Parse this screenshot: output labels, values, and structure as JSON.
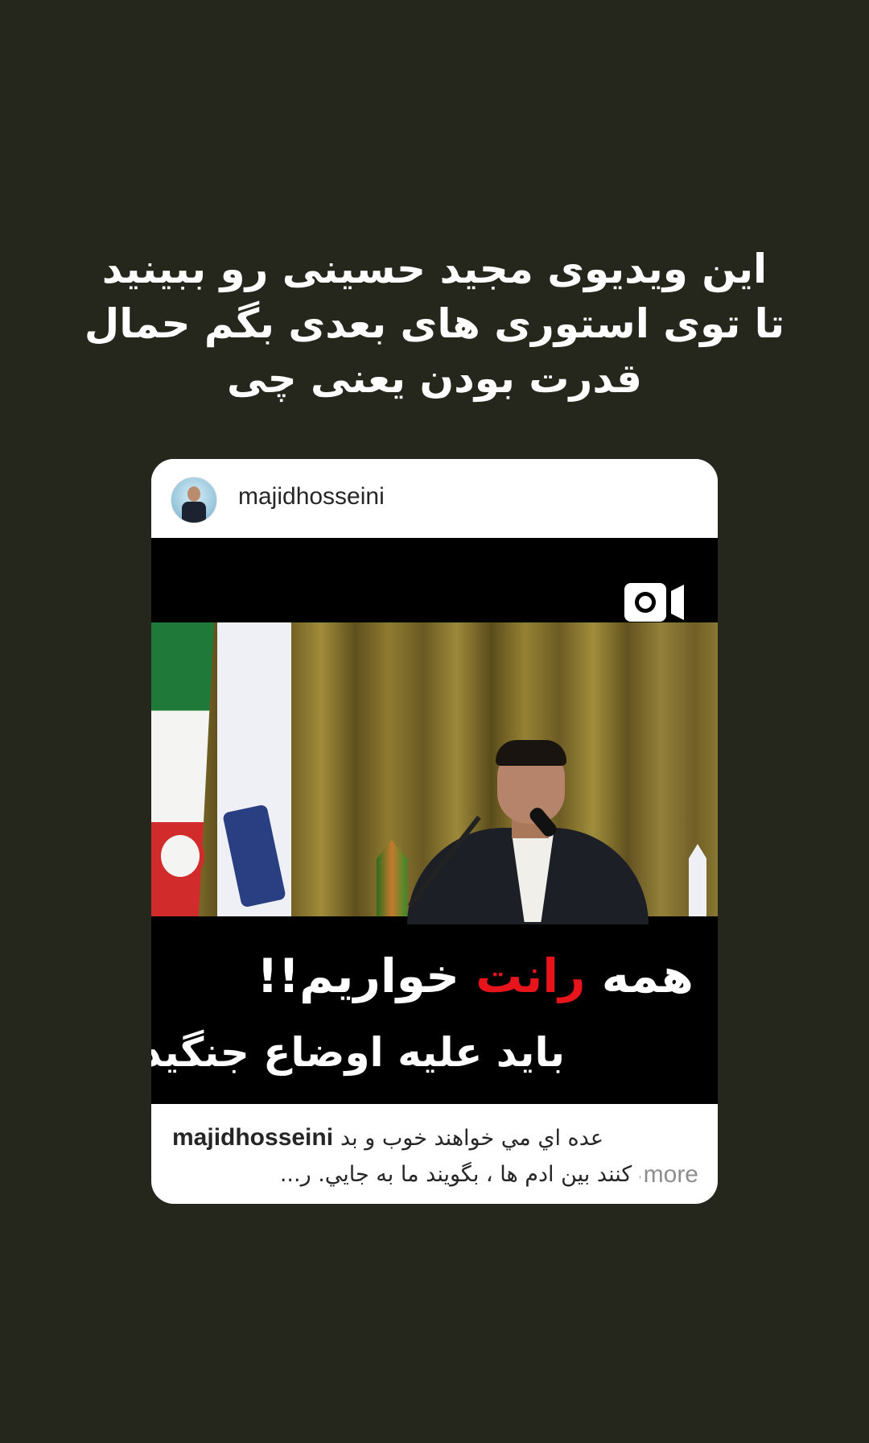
{
  "story": {
    "headline_lines": [
      "این ویدیوی مجید حسینی رو ببینید",
      "تا توی استوری های بعدی بگم حمال",
      "قدرت بودن یعنی چی"
    ]
  },
  "post": {
    "username": "majidhosseini",
    "video_icon": "video-camera-icon",
    "overlay": {
      "line1_before": "همه ",
      "line1_accent": "رانت",
      "line1_after": " خواریم!!",
      "line2": "باید علیه اوضاع جنگید!"
    },
    "caption": {
      "username": "majidhosseini",
      "line1": "عده اي مي خواهند خوب و بد",
      "line2": "درست كنند بين ادم ها ، بگويند ما به جايي. ر...",
      "more_label": "more"
    }
  },
  "colors": {
    "background": "#26271c",
    "card": "#ffffff",
    "accent_red": "#e8141b",
    "muted": "#8e8e8e"
  }
}
